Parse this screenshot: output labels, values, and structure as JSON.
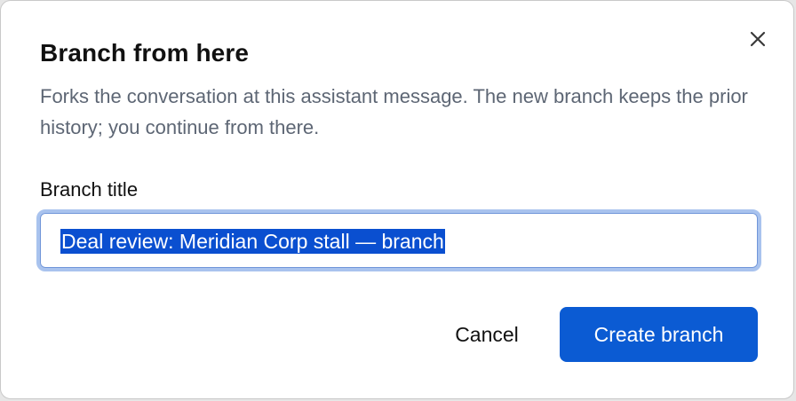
{
  "dialog": {
    "title": "Branch from here",
    "description": "Forks the conversation at this assistant message. The new branch keeps the prior history; you continue from there.",
    "close_icon": "close-icon"
  },
  "form": {
    "label": "Branch title",
    "value": "Deal review: Meridian Corp stall — branch",
    "selected": true
  },
  "actions": {
    "cancel_label": "Cancel",
    "create_label": "Create branch"
  },
  "colors": {
    "primary": "#0b5bd3",
    "selection": "#0a4fd0",
    "focus_ring": "#a9c3ee",
    "muted_text": "#5d6674"
  }
}
